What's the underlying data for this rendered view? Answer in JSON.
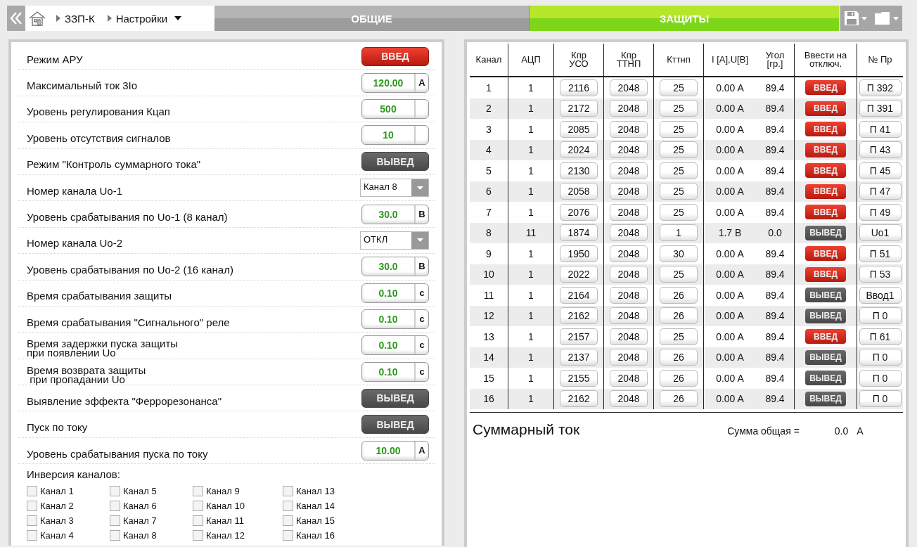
{
  "breadcrumbs": [
    {
      "label": "ЗЗП-К",
      "dropdown": false
    },
    {
      "label": "Настройки",
      "dropdown": true
    }
  ],
  "tabs": [
    {
      "label": "ОБЩИЕ",
      "selected": false
    },
    {
      "label": "ЗАЩИТЫ",
      "selected": true
    }
  ],
  "settings": [
    {
      "label": "Режим АРУ",
      "kind": "toggle",
      "toggle": {
        "label": "ВВЕД",
        "on": true
      }
    },
    {
      "label": "Максимальный ток 3Io",
      "kind": "input",
      "value": "120.00",
      "unit": "А"
    },
    {
      "label": "Уровень регулирования Кцап",
      "kind": "input",
      "value": "500"
    },
    {
      "label": "Уровень отсутствия сигналов",
      "kind": "input",
      "value": "10"
    },
    {
      "label": "Режим \"Контроль суммарного тока\"",
      "kind": "toggle",
      "toggle": {
        "label": "ВЫВЕД",
        "on": false
      }
    },
    {
      "label": "Номер канала Uo-1",
      "kind": "select",
      "value": "Канал 8"
    },
    {
      "label": "Уровень срабатывания по Uo-1 (8 канал)",
      "kind": "input",
      "value": "30.0",
      "unit": "В"
    },
    {
      "label": "Номер канала Uo-2",
      "kind": "select",
      "value": "ОТКЛ"
    },
    {
      "label": "Уровень срабатывания по Uo-2 (16 канал)",
      "kind": "input",
      "value": "30.0",
      "unit": "В"
    },
    {
      "label": "Время срабатывания защиты",
      "kind": "input",
      "value": "0.10",
      "unit": "с"
    },
    {
      "label": "Время срабатывания \"Сигнального\" реле",
      "kind": "input",
      "value": "0.10",
      "unit": "с"
    },
    {
      "label": "Время задержки пуска защиты\nпри появлении Uo",
      "kind": "input",
      "value": "0.10",
      "unit": "с"
    },
    {
      "label": "Время возврата защиты\n при пропадании Uo",
      "kind": "input",
      "value": "0.10",
      "unit": "с"
    },
    {
      "label": "Выявление эффекта \"Феррорезонанса\"",
      "kind": "toggle",
      "toggle": {
        "label": "ВЫВЕД",
        "on": false
      }
    },
    {
      "label": "Пуск по току",
      "kind": "toggle",
      "toggle": {
        "label": "ВЫВЕД",
        "on": false
      }
    },
    {
      "label": "Уровень срабатывания пуска по току",
      "kind": "input",
      "value": "10.00",
      "unit": "А"
    }
  ],
  "inversion": {
    "title": "Инверсия каналов:",
    "channels": [
      {
        "label": "Канал 1",
        "checked": false
      },
      {
        "label": "Канал 2",
        "checked": false
      },
      {
        "label": "Канал 3",
        "checked": false
      },
      {
        "label": "Канал 4",
        "checked": false
      },
      {
        "label": "Канал 5",
        "checked": false
      },
      {
        "label": "Канал 6",
        "checked": false
      },
      {
        "label": "Канал 7",
        "checked": false
      },
      {
        "label": "Канал 8",
        "checked": false
      },
      {
        "label": "Канал 9",
        "checked": false
      },
      {
        "label": "Канал 10",
        "checked": false
      },
      {
        "label": "Канал 11",
        "checked": false
      },
      {
        "label": "Канал 12",
        "checked": false
      },
      {
        "label": "Канал 13",
        "checked": false
      },
      {
        "label": "Канал 14",
        "checked": false
      },
      {
        "label": "Канал 15",
        "checked": false
      },
      {
        "label": "Канал 16",
        "checked": false
      }
    ]
  },
  "table": {
    "columns": [
      "Канал",
      "АЦП",
      "Кпр\nУСО",
      "Кпр\nТТНП",
      "Кттнп",
      "I [A],U[B]",
      "Угол\n[гр.]",
      "Ввести на\nотключ.",
      "№ Пр"
    ],
    "rows": [
      {
        "channel": "1",
        "adc": "1",
        "k_uso": "2116",
        "k_ttnp": "2048",
        "kttnp": "25",
        "reading": "0.00 A",
        "angle": "89.4",
        "trip": {
          "label": "ВВЕД",
          "on": true
        },
        "pr": "П 392"
      },
      {
        "channel": "2",
        "adc": "1",
        "k_uso": "2172",
        "k_ttnp": "2048",
        "kttnp": "25",
        "reading": "0.00 A",
        "angle": "89.4",
        "trip": {
          "label": "ВВЕД",
          "on": true
        },
        "pr": "П 391"
      },
      {
        "channel": "3",
        "adc": "1",
        "k_uso": "2085",
        "k_ttnp": "2048",
        "kttnp": "25",
        "reading": "0.00 A",
        "angle": "89.4",
        "trip": {
          "label": "ВВЕД",
          "on": true
        },
        "pr": "П 41"
      },
      {
        "channel": "4",
        "adc": "1",
        "k_uso": "2024",
        "k_ttnp": "2048",
        "kttnp": "25",
        "reading": "0.00 A",
        "angle": "89.4",
        "trip": {
          "label": "ВВЕД",
          "on": true
        },
        "pr": "П 43"
      },
      {
        "channel": "5",
        "adc": "1",
        "k_uso": "2130",
        "k_ttnp": "2048",
        "kttnp": "25",
        "reading": "0.00 A",
        "angle": "89.4",
        "trip": {
          "label": "ВВЕД",
          "on": true
        },
        "pr": "П 45"
      },
      {
        "channel": "6",
        "adc": "1",
        "k_uso": "2058",
        "k_ttnp": "2048",
        "kttnp": "25",
        "reading": "0.00 A",
        "angle": "89.4",
        "trip": {
          "label": "ВВЕД",
          "on": true
        },
        "pr": "П 47"
      },
      {
        "channel": "7",
        "adc": "1",
        "k_uso": "2076",
        "k_ttnp": "2048",
        "kttnp": "25",
        "reading": "0.00 A",
        "angle": "89.4",
        "trip": {
          "label": "ВВЕД",
          "on": true
        },
        "pr": "П 49"
      },
      {
        "channel": "8",
        "adc": "11",
        "k_uso": "1874",
        "k_ttnp": "2048",
        "kttnp": "1",
        "reading": "1.7 B",
        "angle": "0.0",
        "trip": {
          "label": "ВЫВЕД",
          "on": false
        },
        "pr": "Uo1"
      },
      {
        "channel": "9",
        "adc": "1",
        "k_uso": "1950",
        "k_ttnp": "2048",
        "kttnp": "30",
        "reading": "0.00 A",
        "angle": "89.4",
        "trip": {
          "label": "ВВЕД",
          "on": true
        },
        "pr": "П 51"
      },
      {
        "channel": "10",
        "adc": "1",
        "k_uso": "2022",
        "k_ttnp": "2048",
        "kttnp": "25",
        "reading": "0.00 A",
        "angle": "89.4",
        "trip": {
          "label": "ВВЕД",
          "on": true
        },
        "pr": "П 53"
      },
      {
        "channel": "11",
        "adc": "1",
        "k_uso": "2164",
        "k_ttnp": "2048",
        "kttnp": "26",
        "reading": "0.00 A",
        "angle": "89.4",
        "trip": {
          "label": "ВЫВЕД",
          "on": false
        },
        "pr": "Ввод1"
      },
      {
        "channel": "12",
        "adc": "1",
        "k_uso": "2162",
        "k_ttnp": "2048",
        "kttnp": "26",
        "reading": "0.00 A",
        "angle": "89.4",
        "trip": {
          "label": "ВЫВЕД",
          "on": false
        },
        "pr": "П 0"
      },
      {
        "channel": "13",
        "adc": "1",
        "k_uso": "2157",
        "k_ttnp": "2048",
        "kttnp": "25",
        "reading": "0.00 A",
        "angle": "89.4",
        "trip": {
          "label": "ВВЕД",
          "on": true
        },
        "pr": "П 61"
      },
      {
        "channel": "14",
        "adc": "1",
        "k_uso": "2137",
        "k_ttnp": "2048",
        "kttnp": "26",
        "reading": "0.00 A",
        "angle": "89.4",
        "trip": {
          "label": "ВЫВЕД",
          "on": false
        },
        "pr": "П 0"
      },
      {
        "channel": "15",
        "adc": "1",
        "k_uso": "2155",
        "k_ttnp": "2048",
        "kttnp": "26",
        "reading": "0.00 A",
        "angle": "89.4",
        "trip": {
          "label": "ВЫВЕД",
          "on": false
        },
        "pr": "П 0"
      },
      {
        "channel": "16",
        "adc": "1",
        "k_uso": "2162",
        "k_ttnp": "2048",
        "kttnp": "26",
        "reading": "0.00 A",
        "angle": "89.4",
        "trip": {
          "label": "ВЫВЕД",
          "on": false
        },
        "pr": "П 0"
      }
    ]
  },
  "summary": {
    "title": "Суммарный ток",
    "total_label": "Сумма общая =",
    "total_value": "0.0",
    "total_unit": "А"
  }
}
